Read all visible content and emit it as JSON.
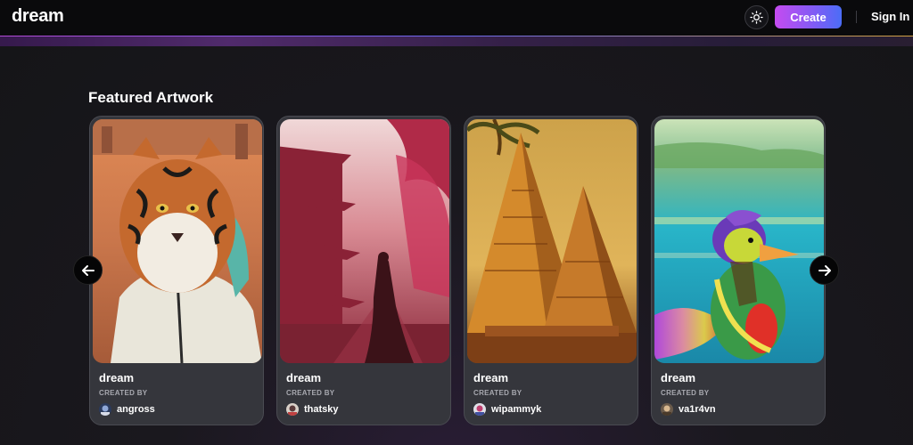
{
  "header": {
    "logo": "dream",
    "theme_toggle_icon": "sun-icon",
    "create_label": "Create",
    "signin_label": "Sign In"
  },
  "main": {
    "section_title": "Featured Artwork",
    "prev_icon": "arrow-left-icon",
    "next_icon": "arrow-right-icon",
    "cards": [
      {
        "title": "dream",
        "created_by_label": "CREATED BY",
        "username": "angross",
        "image_subject": "tiger-in-hoodie"
      },
      {
        "title": "dream",
        "created_by_label": "CREATED BY",
        "username": "thatsky",
        "image_subject": "pagoda-street-figure"
      },
      {
        "title": "dream",
        "created_by_label": "CREATED BY",
        "username": "wipammyk",
        "image_subject": "pyramids"
      },
      {
        "title": "dream",
        "created_by_label": "CREATED BY",
        "username": "va1r4vn",
        "image_subject": "colorful-duck"
      }
    ]
  },
  "colors": {
    "create_gradient_start": "#c54bf0",
    "create_gradient_end": "#4b6df6",
    "card_bg": "#35363c",
    "page_bg": "#17171b"
  }
}
